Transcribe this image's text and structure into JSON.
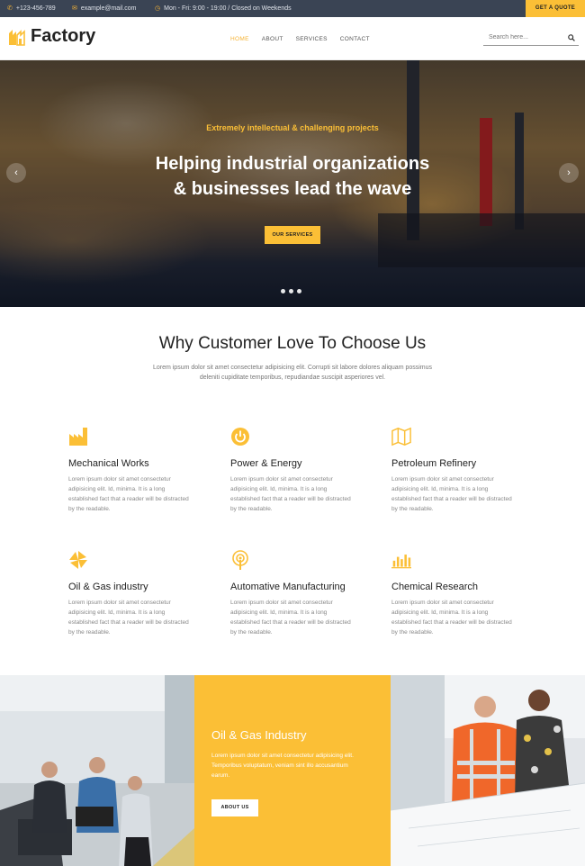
{
  "topbar": {
    "phone": "+123-456-789",
    "email": "example@mail.com",
    "hours": "Mon - Fri: 9:00 - 19:00 / Closed on Weekends",
    "quote_button": "GET A QUOTE"
  },
  "header": {
    "logo_text": "Factory",
    "nav": [
      "HOME",
      "ABOUT",
      "SERVICES",
      "CONTACT"
    ],
    "active_nav": "HOME",
    "search_placeholder": "Search here..."
  },
  "hero": {
    "subtitle": "Extremely intellectual & challenging projects",
    "title_line1": "Helping industrial organizations",
    "title_line2": "& businesses lead the wave",
    "button": "OUR SERVICES",
    "prev_icon": "chevron-left",
    "next_icon": "chevron-right",
    "slide_count": 3
  },
  "why": {
    "title": "Why Customer Love To Choose Us",
    "description": "Lorem ipsum dolor sit amet consectetur adipisicing elit. Corrupti sit labore dolores aliquam possimus deleniti cupiditate temporibus, repudiandae suscipit asperiores vel.",
    "features": [
      {
        "icon": "factory-icon",
        "title": "Mechanical Works",
        "text": "Lorem ipsum dolor sit amet consectetur adipisicing elit. Id, minima. It is a long established fact that a reader will be distracted by the readable."
      },
      {
        "icon": "power-icon",
        "title": "Power & Energy",
        "text": "Lorem ipsum dolor sit amet consectetur adipisicing elit. Id, minima. It is a long established fact that a reader will be distracted by the readable."
      },
      {
        "icon": "map-icon",
        "title": "Petroleum Refinery",
        "text": "Lorem ipsum dolor sit amet consectetur adipisicing elit. Id, minima. It is a long established fact that a reader will be distracted by the readable."
      },
      {
        "icon": "pinwheel-icon",
        "title": "Oil & Gas industry",
        "text": "Lorem ipsum dolor sit amet consectetur adipisicing elit. Id, minima. It is a long established fact that a reader will be distracted by the readable."
      },
      {
        "icon": "antenna-icon",
        "title": "Automative Manufacturing",
        "text": "Lorem ipsum dolor sit amet consectetur adipisicing elit. Id, minima. It is a long established fact that a reader will be distracted by the readable."
      },
      {
        "icon": "bar-chart-icon",
        "title": "Chemical Research",
        "text": "Lorem ipsum dolor sit amet consectetur adipisicing elit. Id, minima. It is a long established fact that a reader will be distracted by the readable."
      }
    ]
  },
  "banner": {
    "title": "Oil & Gas Industry",
    "text": "Lorem ipsum dolor sit amet consectetur adipisicing elit. Temporibus voluptatum, veniam sint illo accusantium earum.",
    "button": "ABOUT US"
  },
  "colors": {
    "accent": "#fbbf36",
    "topbar_bg": "#3a4454",
    "heading": "#222222",
    "body_text": "#888888"
  }
}
